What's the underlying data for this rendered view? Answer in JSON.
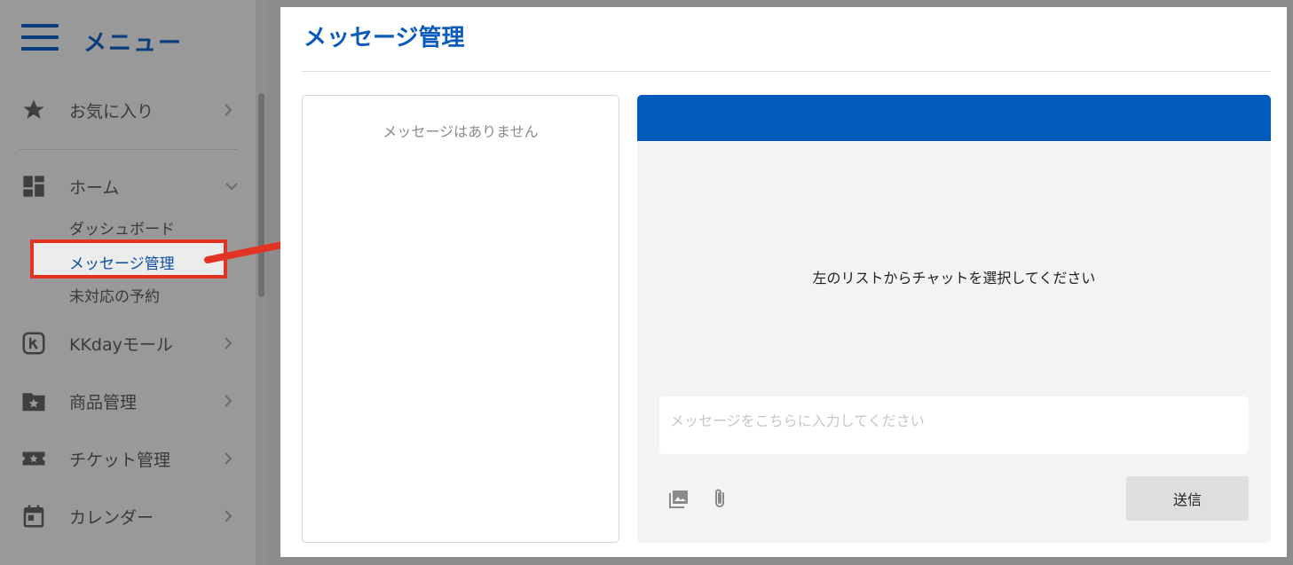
{
  "sidebar": {
    "menu_title": "メニュー",
    "items": [
      {
        "label": "お気に入り",
        "icon": "star-icon"
      },
      {
        "label": "ホーム",
        "icon": "dashboard-icon"
      },
      {
        "label": "KKdayモール",
        "icon": "kkday-icon"
      },
      {
        "label": "商品管理",
        "icon": "folder-star-icon"
      },
      {
        "label": "チケット管理",
        "icon": "ticket-icon"
      },
      {
        "label": "カレンダー",
        "icon": "calendar-icon"
      }
    ],
    "home_sub_items": [
      "ダッシュボード",
      "メッセージ管理",
      "未対応の予約"
    ],
    "active_sub_item": "メッセージ管理"
  },
  "modal": {
    "title": "メッセージ管理",
    "message_list": {
      "empty_text": "メッセージはありません"
    },
    "chat": {
      "prompt": "左のリストからチャットを選択してください",
      "input_placeholder": "メッセージをこちらに入力してください",
      "send_label": "送信"
    }
  },
  "colors": {
    "brand_blue": "#005bbb",
    "highlight_red": "#e23424",
    "overlay_gray": "#999999"
  }
}
